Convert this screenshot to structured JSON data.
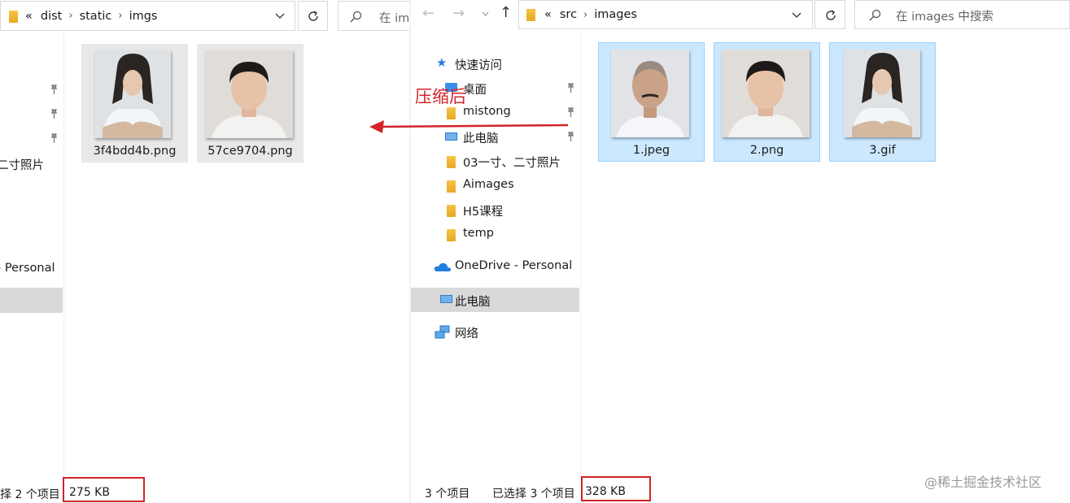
{
  "left_window": {
    "breadcrumb": [
      "«",
      "dist",
      "static",
      "imgs"
    ],
    "search_placeholder": "在 im",
    "nav_partial": [
      "二寸照片",
      "- Personal"
    ],
    "files": [
      {
        "name": "3f4bdd4b.png",
        "person": "long-hair"
      },
      {
        "name": "57ce9704.png",
        "person": "short-hair"
      }
    ],
    "status_left": "择 2 个项目",
    "status_size": "275 KB"
  },
  "right_window": {
    "breadcrumb": [
      "«",
      "src",
      "images"
    ],
    "search_placeholder": "在 images 中搜索",
    "nav_items": [
      {
        "label": "快速访问",
        "icon": "star-icon"
      },
      {
        "label": "桌面",
        "icon": "desktop-icon"
      },
      {
        "label": "mistong",
        "icon": "folder-icon"
      },
      {
        "label": "此电脑",
        "icon": "computer-icon"
      },
      {
        "label": "03一寸、二寸照片",
        "icon": "folder-icon"
      },
      {
        "label": "Aimages",
        "icon": "folder-icon"
      },
      {
        "label": "H5课程",
        "icon": "folder-icon"
      },
      {
        "label": "temp",
        "icon": "folder-icon"
      },
      {
        "label": "OneDrive - Personal",
        "icon": "onedrive-icon"
      },
      {
        "label": "此电脑",
        "icon": "computer-icon"
      },
      {
        "label": "网络",
        "icon": "network-icon"
      }
    ],
    "files": [
      {
        "name": "1.jpeg",
        "person": "bald"
      },
      {
        "name": "2.png",
        "person": "short-hair"
      },
      {
        "name": "3.gif",
        "person": "long-hair"
      }
    ],
    "status_count": "3 个项目",
    "status_selected": "已选择 3 个项目",
    "status_size": "328 KB"
  },
  "annotation": {
    "label": "压缩后",
    "color": "#d2242a"
  },
  "watermark": "@稀土掘金技术社区"
}
